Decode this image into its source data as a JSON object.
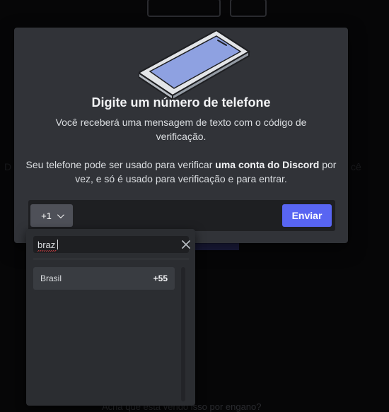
{
  "modal": {
    "title": "Digite um número de telefone",
    "description": "Você receberá uma mensagem de texto com o código de verificação.",
    "note_prefix": "Seu telefone pode ser usado para verificar ",
    "note_bold": "uma conta do Discord",
    "note_suffix": " por vez, e só é usado para verificação e para entrar.",
    "country_code": "+1",
    "send_label": "Enviar"
  },
  "dropdown": {
    "search_value": "braz",
    "results": [
      {
        "name": "Brasil",
        "code": "+55"
      }
    ]
  },
  "background": {
    "left_fragment": "D",
    "right_fragment": "cê",
    "bottom_text": "Acha que está vendo isso por engano?"
  },
  "colors": {
    "modal_bg": "#313338",
    "dropdown_bg": "#2b2d31",
    "brand": "#5865f2",
    "input_bg": "#1e1f22"
  }
}
